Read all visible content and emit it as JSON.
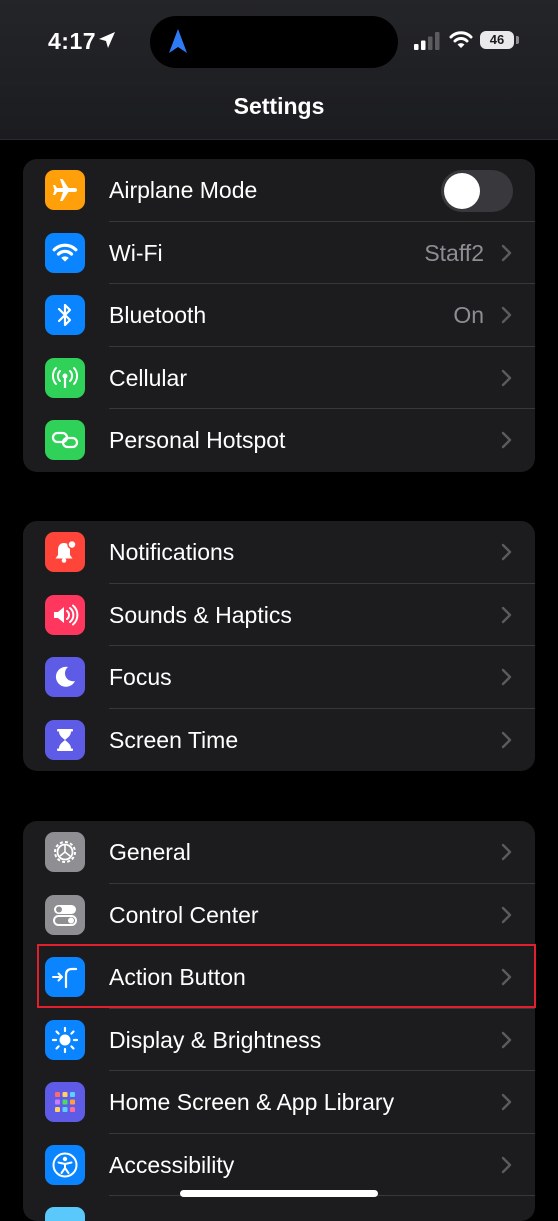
{
  "status_bar": {
    "time": "4:17",
    "battery": "46",
    "icons": [
      "location-arrow-icon",
      "navigation-icon",
      "signal-icon",
      "wifi-icon",
      "battery-icon"
    ]
  },
  "header": {
    "title": "Settings"
  },
  "groups": [
    {
      "rows": [
        {
          "label": "Airplane Mode",
          "icon": "airplane-icon",
          "icon_bg": "#ff9f0a",
          "control": "toggle",
          "toggle_on": false
        },
        {
          "label": "Wi-Fi",
          "icon": "wifi-icon",
          "icon_bg": "#0a84ff",
          "value": "Staff2"
        },
        {
          "label": "Bluetooth",
          "icon": "bluetooth-icon",
          "icon_bg": "#0a84ff",
          "value": "On"
        },
        {
          "label": "Cellular",
          "icon": "cellular-icon",
          "icon_bg": "#30d158"
        },
        {
          "label": "Personal Hotspot",
          "icon": "hotspot-icon",
          "icon_bg": "#30d158"
        }
      ]
    },
    {
      "rows": [
        {
          "label": "Notifications",
          "icon": "bell-icon",
          "icon_bg": "#ff453a"
        },
        {
          "label": "Sounds & Haptics",
          "icon": "speaker-icon",
          "icon_bg": "#ff375f"
        },
        {
          "label": "Focus",
          "icon": "moon-icon",
          "icon_bg": "#5e5ce6"
        },
        {
          "label": "Screen Time",
          "icon": "hourglass-icon",
          "icon_bg": "#5e5ce6"
        }
      ]
    },
    {
      "rows": [
        {
          "label": "General",
          "icon": "gear-icon",
          "icon_bg": "#8e8e93"
        },
        {
          "label": "Control Center",
          "icon": "switches-icon",
          "icon_bg": "#8e8e93"
        },
        {
          "label": "Action Button",
          "icon": "action-button-icon",
          "icon_bg": "#0a84ff",
          "highlighted": true
        },
        {
          "label": "Display & Brightness",
          "icon": "sun-icon",
          "icon_bg": "#0a84ff"
        },
        {
          "label": "Home Screen & App Library",
          "icon": "app-grid-icon",
          "icon_bg": "#5e5ce6"
        },
        {
          "label": "Accessibility",
          "icon": "accessibility-icon",
          "icon_bg": "#0a84ff"
        }
      ]
    }
  ],
  "colors": {
    "background": "#000000",
    "group_bg": "#1c1c1e",
    "secondary_text": "#8d8d93",
    "highlight_border": "#e0202c"
  }
}
